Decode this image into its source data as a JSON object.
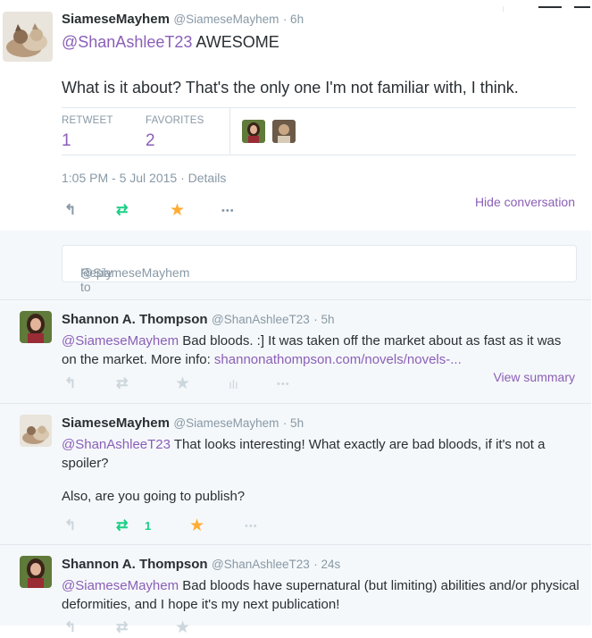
{
  "main_tweet": {
    "name": "SiameseMayhem",
    "handle": "@SiameseMayhem",
    "time_ago": "· 6h",
    "mention": "@ShanAshleeT23",
    "text_line1": " AWESOME",
    "text_line2": "What is it about? That's the only one I'm not familiar with, I think.",
    "retweets_label": "RETWEET",
    "retweets_count": "1",
    "favorites_label": "FAVORITES",
    "favorites_count": "2",
    "timestamp": "1:05 PM - 5 Jul 2015 · Details",
    "hide_conversation": "Hide conversation"
  },
  "reply_box": {
    "placeholder": "Reply to ",
    "mention": "@SiameseMayhem"
  },
  "conversation": [
    {
      "name": "Shannon A. Thompson",
      "handle": "@ShanAshleeT23",
      "time_ago": "· 5h",
      "mention": "@SiameseMayhem",
      "text": " Bad bloods. :]  It was taken off the market about as fast as it was on the market. More info: ",
      "link": "shannonathompson.com/novels/novels-...",
      "view_summary": "View summary"
    },
    {
      "name": "SiameseMayhem",
      "handle": "@SiameseMayhem",
      "time_ago": "· 5h",
      "mention": "@ShanAshleeT23",
      "text": " That looks interesting! What exactly are bad bloods, if it's not a spoiler?",
      "text2": "Also, are you going to publish?",
      "retweet_count": "1"
    },
    {
      "name": "Shannon A. Thompson",
      "handle": "@ShanAshleeT23",
      "time_ago": "· 24s",
      "mention": "@SiameseMayhem",
      "text": " Bad bloods have supernatural (but limiting) abilities and/or physical deformities, and I hope it's my next publication!"
    }
  ],
  "icons": {
    "reply": "↰",
    "retweet": "⇄",
    "favorite": "★",
    "more": "•••",
    "analytics": "ılı"
  },
  "colors": {
    "accent": "#8a5fb8",
    "retweet_green": "#19cf86",
    "favorite_gold": "#ffac33",
    "gray": "#8899a6",
    "light_gray": "#ccd6dd"
  }
}
